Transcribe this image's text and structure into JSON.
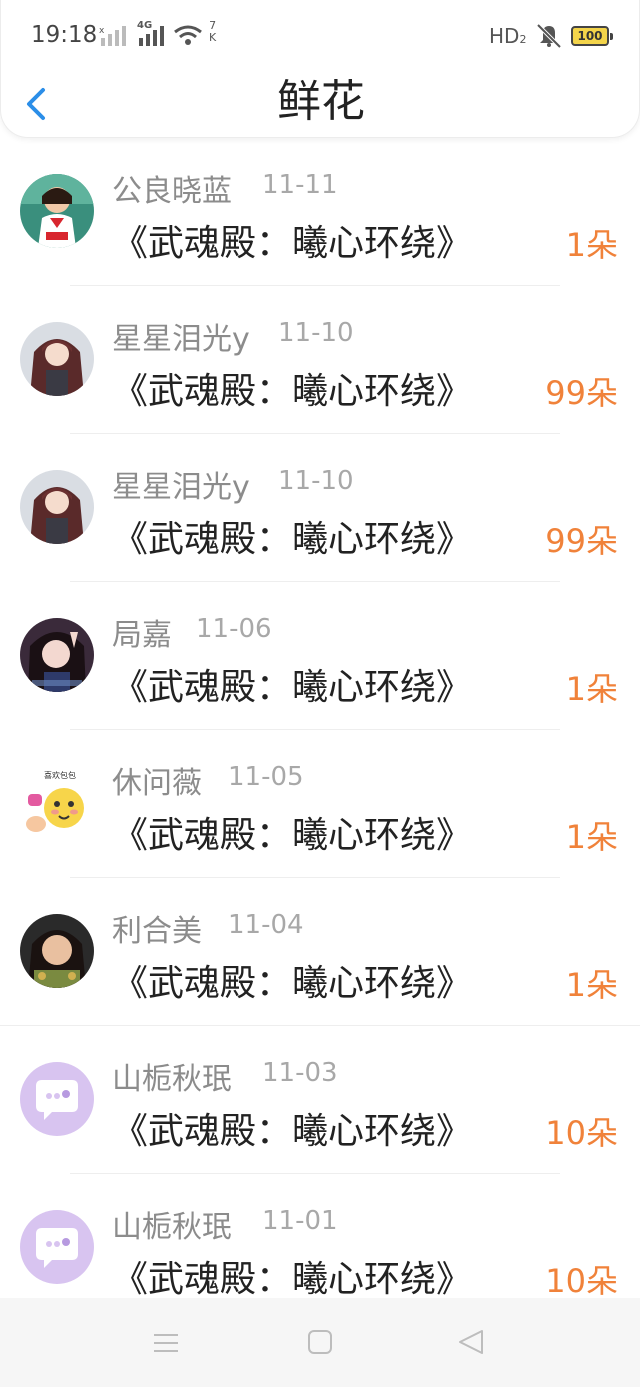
{
  "status_bar": {
    "time": "19:18",
    "network": "4G",
    "speed_top": "7",
    "speed_bottom": "K",
    "hd": "HD",
    "hd_sub": "2",
    "battery": "100"
  },
  "header": {
    "title": "鲜花",
    "back_icon": "chevron-left-icon"
  },
  "colors": {
    "accent_blue": "#2b8ee8",
    "count_orange": "#f0823a",
    "name_gray": "#8c8c8c"
  },
  "items": [
    {
      "name": "公良晓蓝",
      "date": "11-11",
      "book": "《武魂殿：曦心环绕》",
      "count": "1朵",
      "avatar": "avatar-girl-sailor"
    },
    {
      "name": "星星泪光y",
      "date": "11-10",
      "book": "《武魂殿：曦心环绕》",
      "count": "99朵",
      "avatar": "avatar-anime-girl"
    },
    {
      "name": "星星泪光y",
      "date": "11-10",
      "book": "《武魂殿：曦心环绕》",
      "count": "99朵",
      "avatar": "avatar-anime-girl"
    },
    {
      "name": "局嘉",
      "date": "11-06",
      "book": "《武魂殿：曦心环绕》",
      "count": "1朵",
      "avatar": "avatar-girl-peace-sign"
    },
    {
      "name": "休问薇",
      "date": "11-05",
      "book": "《武魂殿：曦心环绕》",
      "count": "1朵",
      "avatar": "avatar-emoji-sticker",
      "avatar_text": "喜欢包包"
    },
    {
      "name": "利合美",
      "date": "11-04",
      "book": "《武魂殿：曦心环绕》",
      "count": "1朵",
      "avatar": "avatar-girl-portrait"
    },
    {
      "name": "山栀秋珉",
      "date": "11-03",
      "book": "《武魂殿：曦心环绕》",
      "count": "10朵",
      "avatar": "avatar-default-chat"
    },
    {
      "name": "山栀秋珉",
      "date": "11-01",
      "book": "《武魂殿：曦心环绕》",
      "count": "10朵",
      "avatar": "avatar-default-chat"
    }
  ],
  "navbar": {
    "menu_icon": "menu-icon",
    "home_icon": "home-square-icon",
    "back_icon": "back-triangle-icon"
  }
}
